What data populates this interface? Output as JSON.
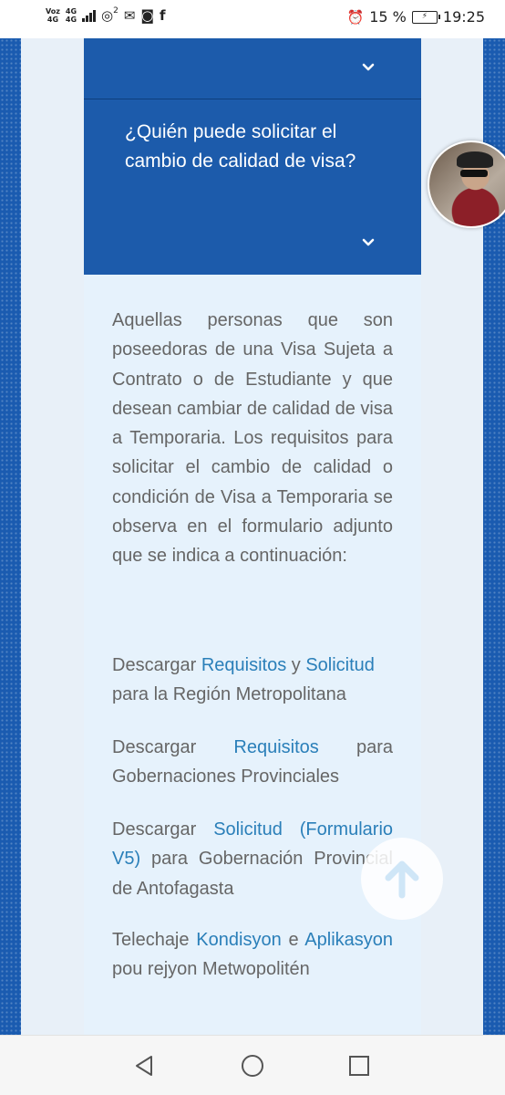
{
  "status_bar": {
    "carrier_line1": "Voz",
    "carrier_line2": "4G",
    "network_line1": "4G",
    "network_line2": "4G",
    "notification_count": "2",
    "icons": [
      "hotspot-icon",
      "mail-icon",
      "instagram-icon",
      "facebook-icon",
      "alarm-icon",
      "battery-icon"
    ],
    "battery_percent": "15 %",
    "time": "19:25"
  },
  "accordion": {
    "item1": {
      "title": "",
      "expanded": false
    },
    "item2": {
      "title": "¿Quién puede solicitar el cambio de calidad de visa?",
      "expanded": true
    },
    "header_color": "#1c5bab"
  },
  "content": {
    "paragraph1": "Aquellas personas que son poseedoras de una Visa Sujeta a Contrato o de Estudiante y que desean cambiar de calidad de visa a Temporaria. Los requisitos para solicitar el cambio de calidad o condición de Visa a Temporaria se observa en el formulario adjunto que se indica a continuación:",
    "p2": {
      "pre": "Descargar ",
      "link1": "Requisitos",
      "mid": " y ",
      "link2": "Solicitud",
      "post": " para la Región Metropolitana"
    },
    "p3": {
      "pre": "Descargar ",
      "link1": "Requisitos",
      "post": " para Gobernaciones Provinciales"
    },
    "p4": {
      "pre": "Descargar ",
      "link1": "Solicitud (Formulario V5)",
      "post": " para Gobernación Provincial de Antofagasta"
    },
    "p5": {
      "pre": "Telechaje ",
      "link1": "Kondisyon",
      "mid": " e ",
      "link2": "Aplikasyon",
      "post": " pou rejyon Metwopolitén"
    },
    "link_color": "#2a7fb9",
    "text_color": "#666666"
  },
  "floating": {
    "avatar": "avatar",
    "scroll_top": "arrow-up-icon"
  },
  "nav_bar": {
    "back": "back-triangle-icon",
    "home": "home-circle-icon",
    "recent": "recent-square-icon"
  }
}
